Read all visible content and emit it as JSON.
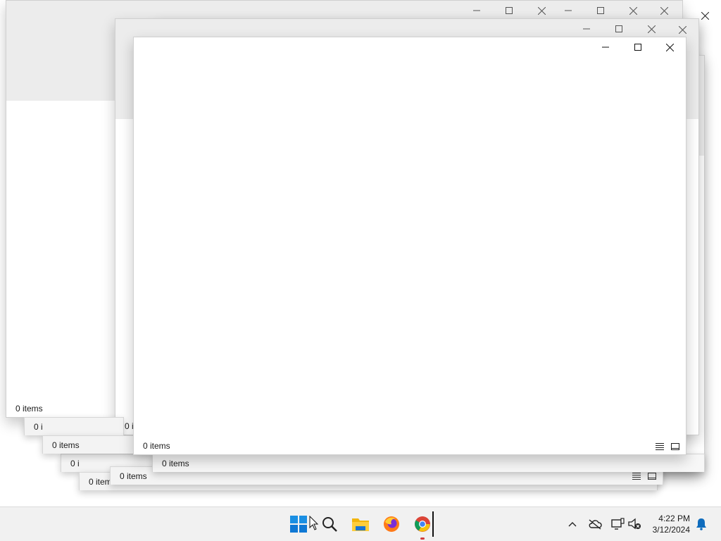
{
  "windows": [
    {
      "status": "0 items"
    },
    {
      "status": "0 items"
    },
    {
      "status": "0 items"
    },
    {
      "status": "0 items"
    }
  ],
  "stacked_panes": [
    {
      "status": "0 i"
    },
    {
      "status": "0 i"
    },
    {
      "status": "0 items"
    },
    {
      "status": "0 items"
    },
    {
      "status": "0 items"
    },
    {
      "status": "0 items"
    }
  ],
  "taskbar": {
    "apps": [
      {
        "name": "start-button-icon"
      },
      {
        "name": "search-icon"
      },
      {
        "name": "file-explorer-icon"
      },
      {
        "name": "firefox-icon"
      },
      {
        "name": "chrome-icon"
      }
    ],
    "clock": {
      "time": "4:22 PM",
      "date": "3/12/2024"
    },
    "accent": "#0078d4"
  }
}
